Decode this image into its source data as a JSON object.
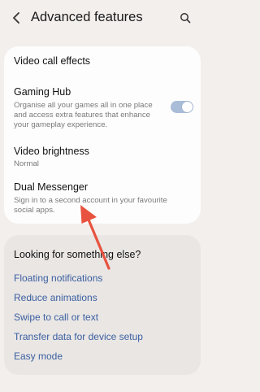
{
  "header": {
    "title": "Advanced features",
    "back_icon": "chevron-left-icon",
    "search_icon": "search-icon"
  },
  "settings": {
    "items": [
      {
        "title": "Video call effects"
      },
      {
        "title": "Gaming Hub",
        "description": "Organise all your games all in one place and access extra features that enhance your gameplay experience.",
        "toggle_on": true
      },
      {
        "title": "Video brightness",
        "value": "Normal"
      },
      {
        "title": "Dual Messenger",
        "description": "Sign in to a second account in your favourite social apps."
      }
    ]
  },
  "suggestions": {
    "title": "Looking for something else?",
    "links": [
      "Floating notifications",
      "Reduce animations",
      "Swipe to call or text",
      "Transfer data for device setup",
      "Easy mode"
    ]
  },
  "colors": {
    "background": "#f3efed",
    "card": "#fdfdfd",
    "link": "#3b5fa0",
    "toggle_track": "#a9bcd8",
    "annotation_arrow": "#e8533f"
  }
}
